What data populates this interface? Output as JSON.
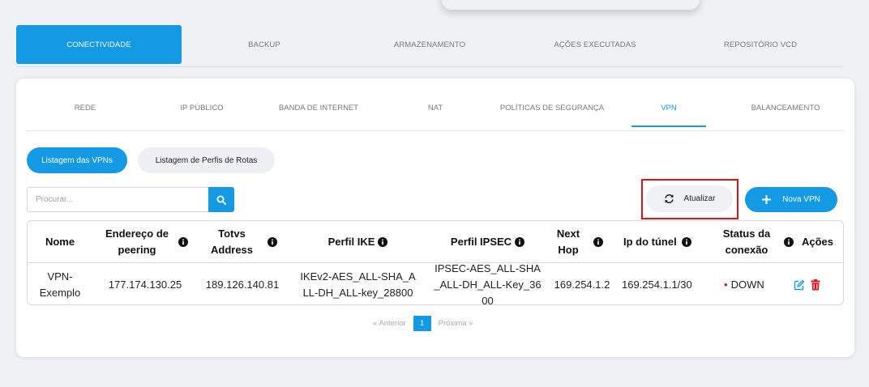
{
  "main_tabs": [
    "CONECTIVIDADE",
    "BACKUP",
    "ARMAZENAMENTO",
    "AÇÕES EXECUTADAS",
    "REPOSITÓRIO VCD"
  ],
  "sub_tabs": [
    "REDE",
    "IP PÚBLICO",
    "BANDA DE INTERNET",
    "NAT",
    "POLÍTICAS DE SEGURANÇA",
    "VPN",
    "BALANCEAMENTO"
  ],
  "pills": {
    "list_vpns": "Listagem das VPNs",
    "list_profiles": "Listagem de Perfis de Rotas"
  },
  "search": {
    "placeholder": "Procurar..."
  },
  "buttons": {
    "refresh": "Atualizar",
    "new_vpn": "Nova VPN"
  },
  "table": {
    "headers": [
      "Nome",
      "Endereço de peering",
      "Totvs Address",
      "Perfil IKE",
      "Perfil IPSEC",
      "Next Hop",
      "Ip do túnel",
      "Status da conexão",
      "Ações"
    ],
    "rows": [
      {
        "nome": "VPN-Exemplo",
        "peering": "177.174.130.25",
        "totvs": "189.126.140.81",
        "ike": "IKEv2-AES_ALL-SHA_ALL-DH_ALL-key_28800",
        "ipsec": "IPSEC-AES_ALL-SHA_ALL-DH_ALL-Key_3600",
        "next_hop": "169.254.1.2",
        "tunnel_ip": "169.254.1.1/30",
        "status": "DOWN"
      }
    ]
  },
  "pagination": {
    "prev": "«  Anterior",
    "page": "1",
    "next": "Próxima  »"
  },
  "colors": {
    "accent": "#1499e4",
    "danger": "#e0131b"
  },
  "icons": [
    "search-icon",
    "refresh-icon",
    "plus-icon",
    "info-icon",
    "edit-icon",
    "trash-icon"
  ]
}
